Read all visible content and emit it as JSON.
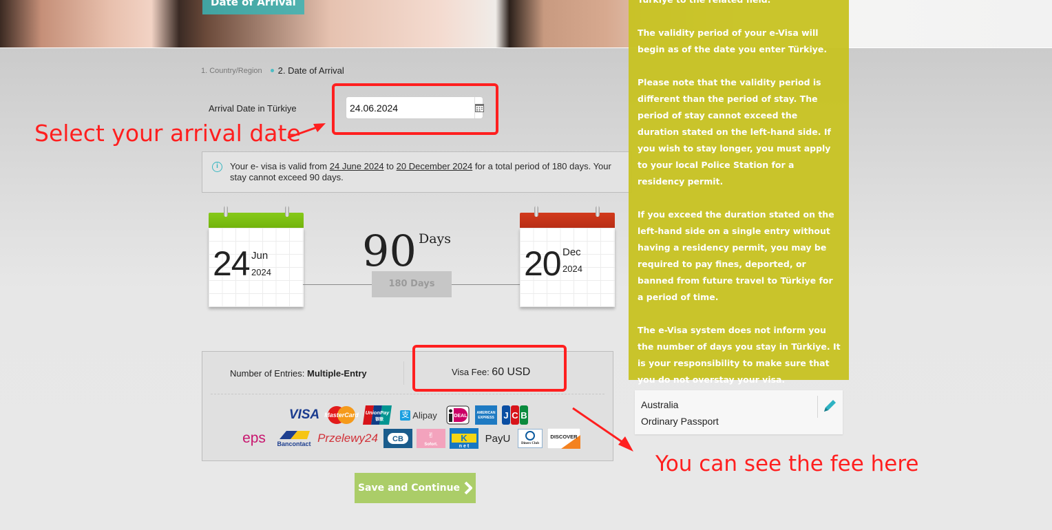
{
  "hero": {
    "tab_label": "Date of Arrival"
  },
  "steps": [
    {
      "label": "1. Country/Region",
      "active": false
    },
    {
      "label": "2. Date of Arrival",
      "active": true
    }
  ],
  "arrival": {
    "label": "Arrival Date in Türkiye",
    "value": "24.06.2024",
    "calendar_icon": "calendar-icon"
  },
  "annotations": {
    "select_date": "Select your arrival date",
    "see_fee": "You can see the fee here",
    "color": "#ff1f1f"
  },
  "info": {
    "icon": "info-icon",
    "prefix": "Your e- visa is valid from ",
    "start": "24 June 2024",
    "mid": " to ",
    "end": "20 December 2024",
    "suffix": " for a total period of 180 days. Your stay cannot exceed 90 days."
  },
  "validity": {
    "start": {
      "day": "24",
      "month": "Jun",
      "year": "2024",
      "color": "#7cbf12"
    },
    "end": {
      "day": "20",
      "month": "Dec",
      "year": "2024",
      "color": "#c9321a"
    },
    "stay_days": "90",
    "stay_unit": "Days",
    "total": "180 Days"
  },
  "fee": {
    "entries_label": "Number of Entries: ",
    "entries_value": "Multiple-Entry",
    "fee_label": "Visa Fee: ",
    "fee_value": "60 USD"
  },
  "payment_methods": {
    "row1": [
      "VISA",
      "MasterCard",
      "UnionPay",
      "Alipay",
      "iDEAL",
      "American Express",
      "JCB"
    ],
    "row2": [
      "eps",
      "Bancontact",
      "Przelewy24",
      "CB",
      "Sofort",
      "K-net",
      "PayU",
      "Diners Club",
      "DISCOVER"
    ]
  },
  "save_button": {
    "label": "Save and Continue",
    "icon": "chevron-right-icon"
  },
  "sidebar": {
    "paragraphs": [
      "Türkiye to the related field.",
      "The validity period of your e-Visa will begin as of the date you enter Türkiye.",
      "Please note that the validity period is different than the period of stay. The period of stay cannot exceed the duration stated on the left-hand side. If you wish to stay longer, you must apply to your local Police Station for a residency permit.",
      "If you exceed the duration stated on the left-hand side on a single entry without having a residency permit, you may be required to pay fines, deported, or banned from future travel to Türkiye for a period of time.",
      "The e-Visa system does not inform you the number of days you stay in Türkiye. It is your responsibility to make sure that you do not overstay your visa."
    ]
  },
  "passport": {
    "country": "Australia",
    "type": "Ordinary Passport",
    "edit_icon": "pencil-icon"
  }
}
